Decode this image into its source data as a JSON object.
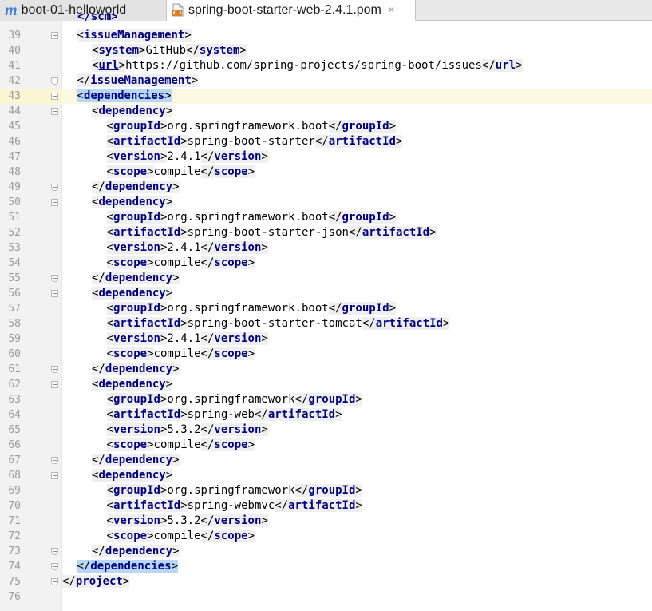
{
  "tabs": [
    {
      "label": "boot-01-helloworld",
      "icon": "maven-module-icon",
      "active": false
    },
    {
      "label": "spring-boot-starter-web-2.4.1.pom",
      "icon": "xml-file-icon",
      "active": true
    }
  ],
  "tab_close": "×",
  "colors": {
    "tag_name": "#000080",
    "line_number": "#9a9a9a",
    "current_line": "#fdf9e0",
    "tag_match": "#b7d7f8",
    "tag_background": "#efefef"
  },
  "current_line": 43,
  "lines": [
    {
      "n": "39",
      "indent": 1,
      "parts": [
        "<",
        {
          "tag": "issueManagement"
        },
        ">"
      ],
      "fold": "open"
    },
    {
      "n": "40",
      "indent": 2,
      "parts": [
        "<",
        {
          "tag": "system"
        },
        ">",
        {
          "text": "GitHub"
        },
        "</",
        {
          "tag": "system"
        },
        ">"
      ]
    },
    {
      "n": "41",
      "indent": 2,
      "parts": [
        "<",
        {
          "tag": "url",
          "link": true
        },
        ">",
        {
          "text": "https://github.com/spring-projects/spring-boot/issues"
        },
        "</",
        {
          "tag": "url"
        },
        ">"
      ]
    },
    {
      "n": "42",
      "indent": 1,
      "parts": [
        "</",
        {
          "tag": "issueManagement"
        },
        ">"
      ],
      "fold": "close"
    },
    {
      "n": "43",
      "indent": 1,
      "parts": [
        "<",
        {
          "tag": "dependencies"
        },
        ">"
      ],
      "fold": "open",
      "highlight": true,
      "caret": true
    },
    {
      "n": "44",
      "indent": 2,
      "parts": [
        "<",
        {
          "tag": "dependency"
        },
        ">"
      ],
      "fold": "open"
    },
    {
      "n": "45",
      "indent": 3,
      "parts": [
        "<",
        {
          "tag": "groupId"
        },
        ">",
        {
          "text": "org.springframework.boot"
        },
        "</",
        {
          "tag": "groupId"
        },
        ">"
      ]
    },
    {
      "n": "46",
      "indent": 3,
      "parts": [
        "<",
        {
          "tag": "artifactId"
        },
        ">",
        {
          "text": "spring-boot-starter"
        },
        "</",
        {
          "tag": "artifactId"
        },
        ">"
      ]
    },
    {
      "n": "47",
      "indent": 3,
      "parts": [
        "<",
        {
          "tag": "version"
        },
        ">",
        {
          "text": "2.4.1"
        },
        "</",
        {
          "tag": "version"
        },
        ">"
      ]
    },
    {
      "n": "48",
      "indent": 3,
      "parts": [
        "<",
        {
          "tag": "scope"
        },
        ">",
        {
          "text": "compile"
        },
        "</",
        {
          "tag": "scope"
        },
        ">"
      ]
    },
    {
      "n": "49",
      "indent": 2,
      "parts": [
        "</",
        {
          "tag": "dependency"
        },
        ">"
      ],
      "fold": "close"
    },
    {
      "n": "50",
      "indent": 2,
      "parts": [
        "<",
        {
          "tag": "dependency"
        },
        ">"
      ],
      "fold": "open"
    },
    {
      "n": "51",
      "indent": 3,
      "parts": [
        "<",
        {
          "tag": "groupId"
        },
        ">",
        {
          "text": "org.springframework.boot"
        },
        "</",
        {
          "tag": "groupId"
        },
        ">"
      ]
    },
    {
      "n": "52",
      "indent": 3,
      "parts": [
        "<",
        {
          "tag": "artifactId"
        },
        ">",
        {
          "text": "spring-boot-starter-json"
        },
        "</",
        {
          "tag": "artifactId"
        },
        ">"
      ]
    },
    {
      "n": "53",
      "indent": 3,
      "parts": [
        "<",
        {
          "tag": "version"
        },
        ">",
        {
          "text": "2.4.1"
        },
        "</",
        {
          "tag": "version"
        },
        ">"
      ]
    },
    {
      "n": "54",
      "indent": 3,
      "parts": [
        "<",
        {
          "tag": "scope"
        },
        ">",
        {
          "text": "compile"
        },
        "</",
        {
          "tag": "scope"
        },
        ">"
      ]
    },
    {
      "n": "55",
      "indent": 2,
      "parts": [
        "</",
        {
          "tag": "dependency"
        },
        ">"
      ],
      "fold": "close"
    },
    {
      "n": "56",
      "indent": 2,
      "parts": [
        "<",
        {
          "tag": "dependency"
        },
        ">"
      ],
      "fold": "open"
    },
    {
      "n": "57",
      "indent": 3,
      "parts": [
        "<",
        {
          "tag": "groupId"
        },
        ">",
        {
          "text": "org.springframework.boot"
        },
        "</",
        {
          "tag": "groupId"
        },
        ">"
      ]
    },
    {
      "n": "58",
      "indent": 3,
      "parts": [
        "<",
        {
          "tag": "artifactId"
        },
        ">",
        {
          "text": "spring-boot-starter-tomcat"
        },
        "</",
        {
          "tag": "artifactId"
        },
        ">"
      ]
    },
    {
      "n": "59",
      "indent": 3,
      "parts": [
        "<",
        {
          "tag": "version"
        },
        ">",
        {
          "text": "2.4.1"
        },
        "</",
        {
          "tag": "version"
        },
        ">"
      ]
    },
    {
      "n": "60",
      "indent": 3,
      "parts": [
        "<",
        {
          "tag": "scope"
        },
        ">",
        {
          "text": "compile"
        },
        "</",
        {
          "tag": "scope"
        },
        ">"
      ]
    },
    {
      "n": "61",
      "indent": 2,
      "parts": [
        "</",
        {
          "tag": "dependency"
        },
        ">"
      ],
      "fold": "close"
    },
    {
      "n": "62",
      "indent": 2,
      "parts": [
        "<",
        {
          "tag": "dependency"
        },
        ">"
      ],
      "fold": "open"
    },
    {
      "n": "63",
      "indent": 3,
      "parts": [
        "<",
        {
          "tag": "groupId"
        },
        ">",
        {
          "text": "org.springframework"
        },
        "</",
        {
          "tag": "groupId"
        },
        ">"
      ]
    },
    {
      "n": "64",
      "indent": 3,
      "parts": [
        "<",
        {
          "tag": "artifactId"
        },
        ">",
        {
          "text": "spring-web"
        },
        "</",
        {
          "tag": "artifactId"
        },
        ">"
      ]
    },
    {
      "n": "65",
      "indent": 3,
      "parts": [
        "<",
        {
          "tag": "version"
        },
        ">",
        {
          "text": "5.3.2"
        },
        "</",
        {
          "tag": "version"
        },
        ">"
      ]
    },
    {
      "n": "66",
      "indent": 3,
      "parts": [
        "<",
        {
          "tag": "scope"
        },
        ">",
        {
          "text": "compile"
        },
        "</",
        {
          "tag": "scope"
        },
        ">"
      ]
    },
    {
      "n": "67",
      "indent": 2,
      "parts": [
        "</",
        {
          "tag": "dependency"
        },
        ">"
      ],
      "fold": "close"
    },
    {
      "n": "68",
      "indent": 2,
      "parts": [
        "<",
        {
          "tag": "dependency"
        },
        ">"
      ],
      "fold": "open"
    },
    {
      "n": "69",
      "indent": 3,
      "parts": [
        "<",
        {
          "tag": "groupId"
        },
        ">",
        {
          "text": "org.springframework"
        },
        "</",
        {
          "tag": "groupId"
        },
        ">"
      ]
    },
    {
      "n": "70",
      "indent": 3,
      "parts": [
        "<",
        {
          "tag": "artifactId"
        },
        ">",
        {
          "text": "spring-webmvc"
        },
        "</",
        {
          "tag": "artifactId"
        },
        ">"
      ]
    },
    {
      "n": "71",
      "indent": 3,
      "parts": [
        "<",
        {
          "tag": "version"
        },
        ">",
        {
          "text": "5.3.2"
        },
        "</",
        {
          "tag": "version"
        },
        ">"
      ]
    },
    {
      "n": "72",
      "indent": 3,
      "parts": [
        "<",
        {
          "tag": "scope"
        },
        ">",
        {
          "text": "compile"
        },
        "</",
        {
          "tag": "scope"
        },
        ">"
      ]
    },
    {
      "n": "73",
      "indent": 2,
      "parts": [
        "</",
        {
          "tag": "dependency"
        },
        ">"
      ],
      "fold": "close"
    },
    {
      "n": "74",
      "indent": 1,
      "parts": [
        "</",
        {
          "tag": "dependencies"
        },
        ">"
      ],
      "fold": "close",
      "highlight": true
    },
    {
      "n": "75",
      "indent": 0,
      "parts": [
        "</",
        {
          "tag": "project"
        },
        ">"
      ],
      "fold": "close"
    },
    {
      "n": "76",
      "indent": 0,
      "parts": []
    }
  ]
}
